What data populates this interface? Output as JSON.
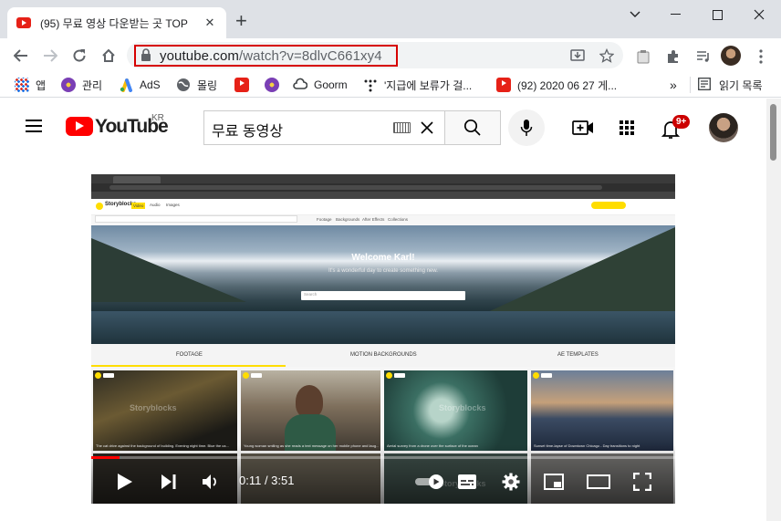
{
  "browser": {
    "tab": {
      "title": "(95) 무료 영상 다운받는 곳 TOP"
    },
    "url": {
      "host": "youtube.com",
      "path": "/watch?v=8dlvC661xy4"
    },
    "bookmarks": [
      {
        "label": "앱",
        "icon": "apps-grid-icon"
      },
      {
        "label": "관리",
        "icon": "purple-flower-icon"
      },
      {
        "label": "AdS",
        "icon": "google-ads-icon"
      },
      {
        "label": "몰링",
        "icon": "globe-icon"
      },
      {
        "label": "",
        "icon": "youtube-icon"
      },
      {
        "label": "",
        "icon": "purple-flower-icon"
      },
      {
        "label": "Goorm",
        "icon": "goorm-cloud-icon"
      },
      {
        "label": "'지급에 보류가 걸...",
        "icon": "dots-icon"
      },
      {
        "label": "(92) 2020 06 27 게...",
        "icon": "youtube-icon"
      }
    ],
    "bookmarks_overflow": "»",
    "reading_list": "읽기 목록"
  },
  "youtube": {
    "logo_text": "YouTube",
    "country": "KR",
    "search_query": "무료 동영상",
    "notification_count": "9+"
  },
  "video": {
    "time": "0:11 / 3:51",
    "progress": 0.048,
    "frame": {
      "brand": "Storyblocks",
      "nav_tabs": [
        "Video",
        "Audio",
        "Images"
      ],
      "sub_nav": [
        "Footage",
        "Backgrounds",
        "After Effects",
        "Collections"
      ],
      "welcome": "Welcome Karl!",
      "welcome_sub": "It's a wonderful day to create something new.",
      "search_placeholder": "Search",
      "sections": [
        "FOOTAGE",
        "MOTION BACKGROUNDS",
        "AE TEMPLATES"
      ],
      "watermark": "Storyblocks",
      "thumbnails": [
        {
          "caption": "The cat drive against the background of building. Evening night time. Blue the ca..."
        },
        {
          "caption": "Young woman smiling as she reads a text message on her mobile phone and laug..."
        },
        {
          "caption": "Aerial survey from a drone over the surface of the ocean"
        },
        {
          "caption": "Sunset time-lapse of Downtown Chicago - Day transitions to night"
        }
      ]
    }
  }
}
